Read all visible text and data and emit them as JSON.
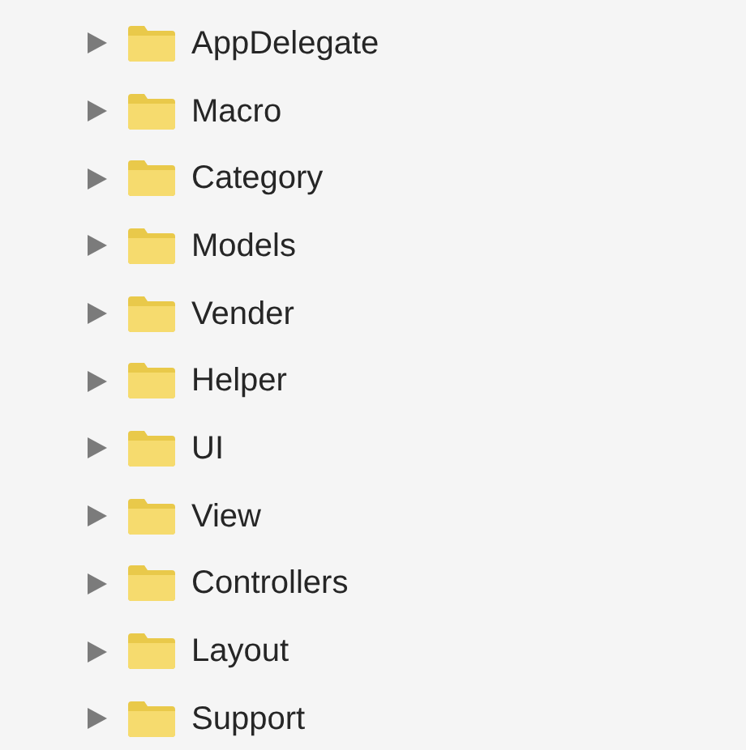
{
  "folders": [
    {
      "name": "AppDelegate",
      "expanded": false
    },
    {
      "name": "Macro",
      "expanded": false
    },
    {
      "name": "Category",
      "expanded": false
    },
    {
      "name": "Models",
      "expanded": false
    },
    {
      "name": "Vender",
      "expanded": false
    },
    {
      "name": "Helper",
      "expanded": false
    },
    {
      "name": "UI",
      "expanded": false
    },
    {
      "name": "View",
      "expanded": false
    },
    {
      "name": "Controllers",
      "expanded": false
    },
    {
      "name": "Layout",
      "expanded": false
    },
    {
      "name": "Support",
      "expanded": false
    }
  ]
}
